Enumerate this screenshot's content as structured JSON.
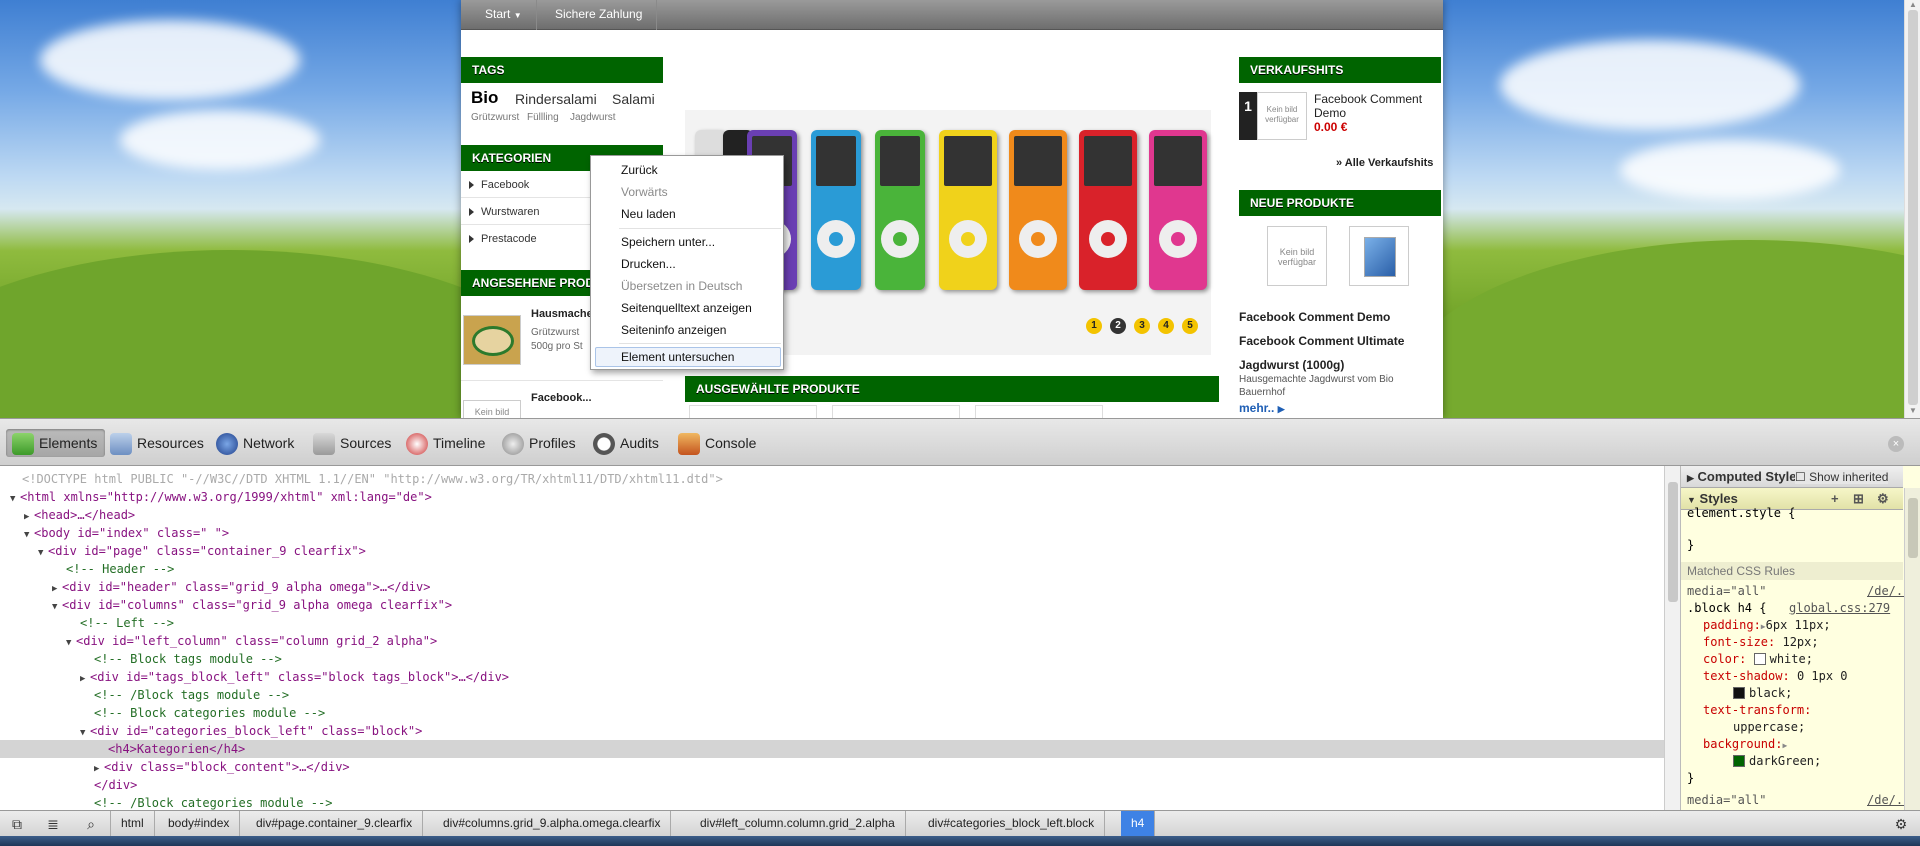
{
  "site": {
    "nav": [
      "Start",
      "Sichere Zahlung"
    ],
    "tags": {
      "title": "TAGS",
      "big": [
        "Bio",
        "Rindersalami",
        "Salami"
      ],
      "small": [
        "Grützwurst",
        "Füllling",
        "Jagdwurst"
      ]
    },
    "categories": {
      "title": "KATEGORIEN",
      "items": [
        "Facebook",
        "Wurstwaren",
        "Prestacode"
      ]
    },
    "viewed": {
      "title": "ANGESEHENE PRODUKTE",
      "item1_title": "Hausmacher",
      "item1_desc1": "Grützwurst",
      "item1_desc2": "500g pro St",
      "item2_title": "Facebook...",
      "item2_img": "Kein bild"
    },
    "slider_dots": [
      "1",
      "2",
      "3",
      "4",
      "5"
    ],
    "featured_title": "AUSGEWÄHLTE PRODUKTE",
    "bestsellers": {
      "title": "VERKAUFSHITS",
      "rank": "1",
      "img_text": "Kein bild verfügbar",
      "product": "Facebook Comment Demo",
      "price": "0.00 €",
      "all_link": "» Alle Verkaufshits"
    },
    "newproducts": {
      "title": "NEUE PRODUKTE",
      "img_text": "Kein bild verfügbar",
      "items": [
        "Facebook Comment Demo",
        "Facebook Comment Ultimate",
        "Jagdwurst (1000g)"
      ],
      "desc1": "Hausgemachte Jagdwurst vom Bio",
      "desc2": "Bauernhof",
      "more": "mehr.."
    }
  },
  "context_menu": {
    "items": [
      "Zurück",
      "Vorwärts",
      "Neu laden",
      "Speichern unter...",
      "Drucken...",
      "Übersetzen in Deutsch",
      "Seitenquelltext anzeigen",
      "Seiteninfo anzeigen",
      "Element untersuchen"
    ]
  },
  "devtools": {
    "tabs": [
      "Elements",
      "Resources",
      "Network",
      "Sources",
      "Timeline",
      "Profiles",
      "Audits",
      "Console"
    ],
    "dom_lines": [
      "<!DOCTYPE html PUBLIC \"-//W3C//DTD XHTML 1.1//EN\" \"http://www.w3.org/TR/xhtml11/DTD/xhtml11.dtd\">",
      "<html xmlns=\"http://www.w3.org/1999/xhtml\" xml:lang=\"de\">",
      "<head>…</head>",
      "<body id=\"index\" class=\" \">",
      "<div id=\"page\" class=\"container_9 clearfix\">",
      "<!-- Header -->",
      "<div id=\"header\" class=\"grid_9 alpha omega\">…</div>",
      "<div id=\"columns\" class=\"grid_9 alpha omega clearfix\">",
      "<!-- Left -->",
      "<div id=\"left_column\" class=\"column grid_2 alpha\">",
      "<!-- Block tags module -->",
      "<div id=\"tags_block_left\" class=\"block tags_block\">…</div>",
      "<!-- /Block tags module -->",
      "<!-- Block categories module -->",
      "<div id=\"categories_block_left\" class=\"block\">",
      "<h4>Kategorien</h4>",
      "<div class=\"block_content\">…</div>",
      "</div>",
      "<!-- /Block categories module -->"
    ],
    "styles": {
      "computed": "Computed Style",
      "show_inherited": "Show inherited",
      "styles_title": "Styles",
      "element_style": "element.style {",
      "close_brace": "}",
      "matched": "Matched CSS Rules",
      "media": "media=\"all\"",
      "source_link": "/de/...",
      "selector": ".block h4 {",
      "file": "global.css:279",
      "props": [
        {
          "name": "padding:",
          "value": "6px 11px;"
        },
        {
          "name": "font-size:",
          "value": "12px;"
        },
        {
          "name": "color:",
          "value": "white;"
        },
        {
          "name": "text-shadow:",
          "value": "0 1px 0"
        },
        {
          "name": "",
          "value": "black;"
        },
        {
          "name": "text-transform:",
          "value": ""
        },
        {
          "name": "",
          "value": "uppercase;"
        },
        {
          "name": "background:",
          "value": ""
        },
        {
          "name": "",
          "value": "darkGreen;"
        }
      ],
      "media2": "media=\"all\"",
      "source2": "/de/..."
    },
    "breadcrumbs": [
      "html",
      "body#index",
      "div#page.container_9.clearfix",
      "div#columns.grid_9.alpha.omega.clearfix",
      "div#left_column.column.grid_2.alpha",
      "div#categories_block_left.block",
      "h4"
    ]
  },
  "colors": {
    "accent_green": "#006400",
    "price_red": "#cc0000",
    "selected_crumb": "#3e82e5"
  }
}
